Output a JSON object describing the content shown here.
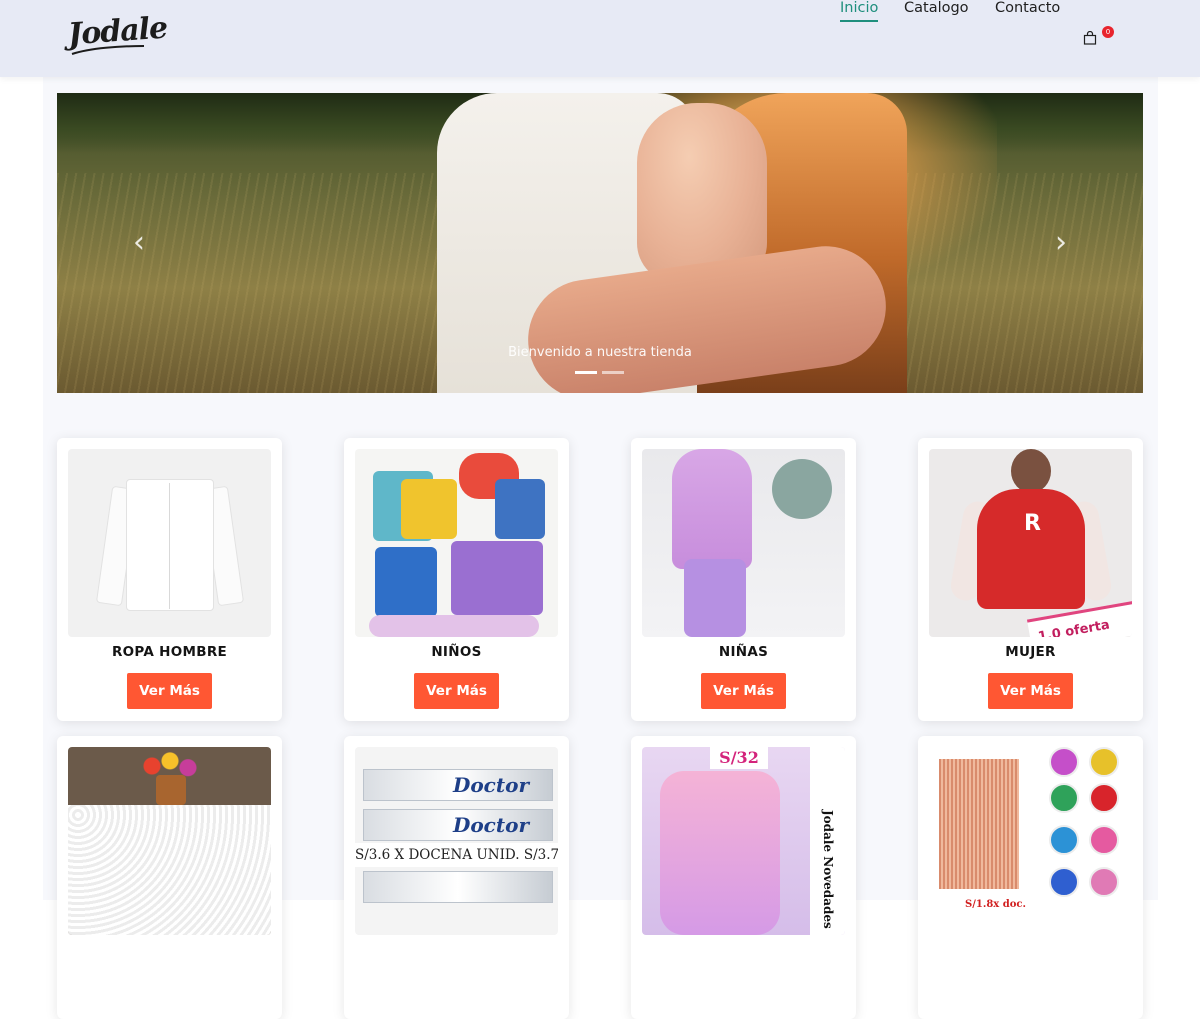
{
  "header": {
    "logo_text": "Jodale",
    "nav": [
      {
        "label": "Inicio",
        "active": true
      },
      {
        "label": "Catalogo",
        "active": false
      },
      {
        "label": "Contacto",
        "active": false
      }
    ],
    "cart_count": "0",
    "cart_icon": "shopping-bag-icon",
    "accent_color": "#1f8f7d",
    "header_bg": "#e7eaf5"
  },
  "hero": {
    "caption": "Bienvenido a nuestra tienda",
    "prev_icon": "chevron-left-icon",
    "next_icon": "chevron-right-icon",
    "prev_glyph": "‹",
    "next_glyph": "›",
    "slides_count": 2,
    "active_slide": 1
  },
  "categories": [
    {
      "title": "ROPA HOMBRE",
      "button": "Ver Más"
    },
    {
      "title": "NIÑOS",
      "button": "Ver Más"
    },
    {
      "title": "NIÑAS",
      "button": "Ver Más"
    },
    {
      "title": "MUJER",
      "button": "Ver Más"
    }
  ],
  "thumb_text": {
    "woman_sticker": "1.0 oferta",
    "tooth_brand": "Doctor",
    "tooth_band": "S/3.6 X DOCENA UNID. S/3.7",
    "bag_price": "S/32",
    "bag_side": "Jodale Novedades",
    "party_price": "S/1.8x doc.",
    "woman_letter": "R"
  },
  "button_color": "#ff5733"
}
